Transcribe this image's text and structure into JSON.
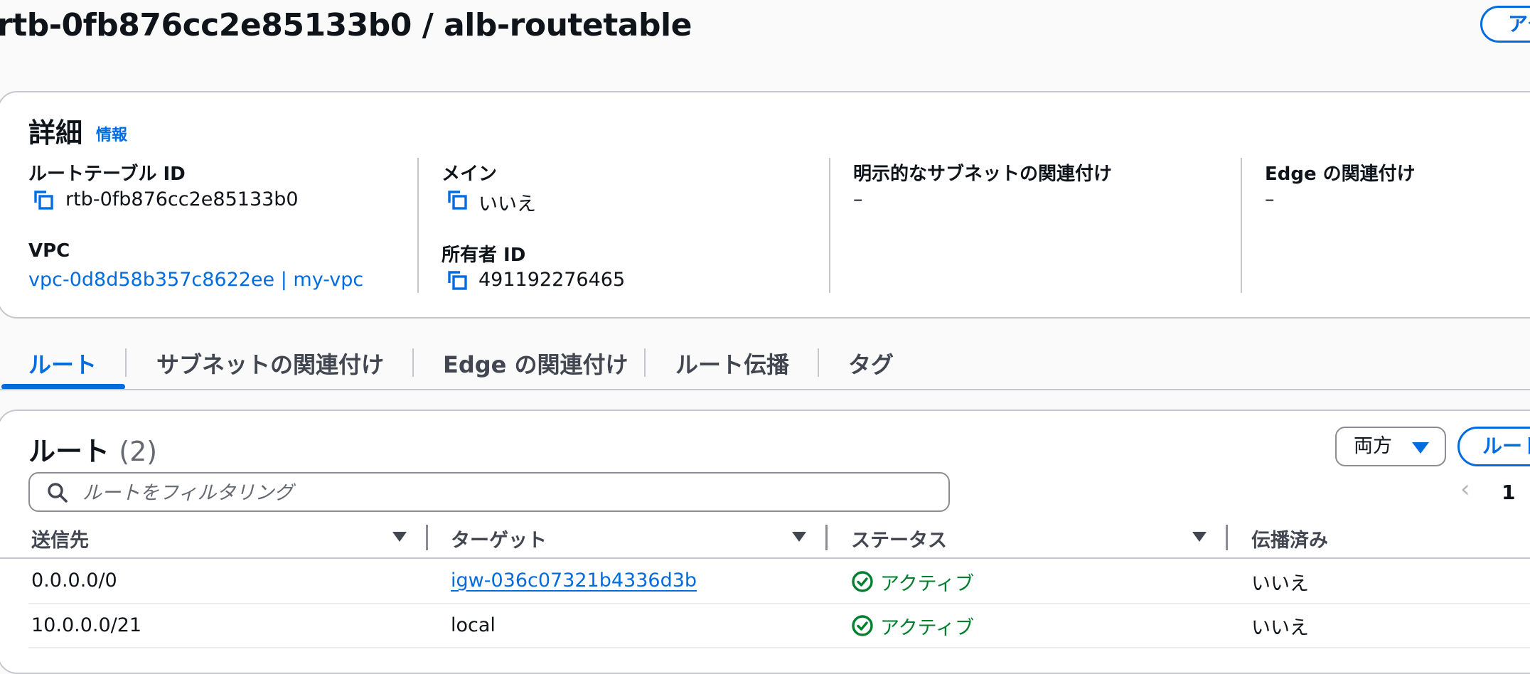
{
  "header": {
    "title": "rtb-0fb876cc2e85133b0 / alb-routetable",
    "action_label": "アクション"
  },
  "details": {
    "heading": "詳細",
    "info_link": "情報",
    "fields": {
      "route_table_id_label": "ルートテーブル ID",
      "route_table_id_value": "rtb-0fb876cc2e85133b0",
      "vpc_label": "VPC",
      "vpc_value": "vpc-0d8d58b357c8622ee | my-vpc",
      "main_label": "メイン",
      "main_value": "いいえ",
      "owner_label": "所有者 ID",
      "owner_value": "491192276465",
      "subnet_assoc_label": "明示的なサブネットの関連付け",
      "subnet_assoc_value": "–",
      "edge_assoc_label": "Edge の関連付け",
      "edge_assoc_value": "–"
    }
  },
  "tabs": [
    {
      "label": "ルート",
      "active": true
    },
    {
      "label": "サブネットの関連付け",
      "active": false
    },
    {
      "label": "Edge の関連付け",
      "active": false
    },
    {
      "label": "ルート伝播",
      "active": false
    },
    {
      "label": "タグ",
      "active": false
    }
  ],
  "routes": {
    "heading": "ルート",
    "count": "(2)",
    "filter_select_value": "両方",
    "edit_button_label": "ルートを編集",
    "search_placeholder": "ルートをフィルタリング",
    "pagination": {
      "current_page": "1"
    },
    "columns": [
      "送信先",
      "ターゲット",
      "ステータス",
      "伝播済み"
    ],
    "rows": [
      {
        "destination": "0.0.0.0/0",
        "target": "igw-036c07321b4336d3b",
        "status": "アクティブ",
        "propagated": "いいえ"
      },
      {
        "destination": "10.0.0.0/21",
        "target": "local",
        "status": "アクティブ",
        "propagated": "いいえ"
      }
    ]
  },
  "colors": {
    "accent": "#006ce0",
    "status_success": "#00802f",
    "border": "#c6c6cd"
  },
  "icons": {
    "copy": "copy-icon",
    "search": "search-icon",
    "caret": "caret-down-icon",
    "sort": "sort-icon",
    "status": "check-circle-icon",
    "prev": "chevron-left-icon"
  }
}
